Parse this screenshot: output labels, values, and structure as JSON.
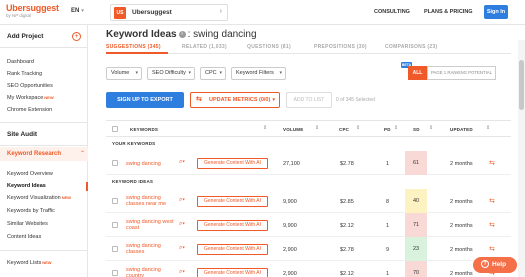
{
  "header": {
    "logo": "Ubersuggest",
    "logo_sub": "by NP digital",
    "language": "EN",
    "project_badge": "US",
    "project_name": "Ubersuggest",
    "nav": [
      "CONSULTING",
      "PLANS & PRICING"
    ],
    "signin": "Sign In"
  },
  "sidebar": {
    "add_project": "Add Project",
    "top_items": [
      {
        "label": "Dashboard",
        "new": false
      },
      {
        "label": "Rank Tracking",
        "new": false
      },
      {
        "label": "SEO Opportunities",
        "new": false
      },
      {
        "label": "My Workspace",
        "new": true
      },
      {
        "label": "Chrome Extension",
        "new": false
      }
    ],
    "site_audit": "Site Audit",
    "keyword_research": "Keyword Research",
    "kr_items": [
      {
        "label": "Keyword Overview",
        "new": false,
        "active": false
      },
      {
        "label": "Keyword Ideas",
        "new": false,
        "active": true
      },
      {
        "label": "Keyword Visualization",
        "new": true,
        "active": false
      },
      {
        "label": "Keywords by Traffic",
        "new": false,
        "active": false
      },
      {
        "label": "Similar Websites",
        "new": false,
        "active": false
      },
      {
        "label": "Content Ideas",
        "new": false,
        "active": false
      }
    ],
    "keyword_lists": "Keyword Lists",
    "new_label": "NEW"
  },
  "main": {
    "title_bold": "Keyword Ideas",
    "title_term": "swing dancing",
    "tabs": [
      "SUGGESTIONS (345)",
      "RELATED (1,033)",
      "QUESTIONS (81)",
      "PREPOSITIONS (30)",
      "COMPARISONS (23)"
    ],
    "filters": [
      "Volume",
      "SEO Difficulty",
      "CPC",
      "Keyword Filters"
    ],
    "beta": "BETA",
    "seg_all": "ALL",
    "seg_page": "PAGE 1 RANKING POTENTIAL",
    "export_btn": "SIGN UP TO EXPORT",
    "update_btn": "UPDATE METRICS (0/0)",
    "add_list_btn": "ADD TO LIST",
    "selected": "0 of 345 Selected",
    "table": {
      "headers": [
        "KEYWORDS",
        "VOLUME",
        "CPC",
        "PD",
        "SD",
        "UPDATED"
      ],
      "your_keywords_label": "YOUR KEYWORDS",
      "keyword_ideas_label": "KEYWORD IDEAS",
      "generate_label": "Generate Content With AI",
      "your_keywords": [
        {
          "keyword": "swing dancing",
          "volume": "27,100",
          "cpc": "$2.78",
          "pd": "1",
          "sd": "61",
          "updated": "2 months"
        }
      ],
      "ideas": [
        {
          "keyword": "swing dancing classes near me",
          "volume": "9,900",
          "cpc": "$2.85",
          "pd": "8",
          "sd": "40",
          "updated": "2 months"
        },
        {
          "keyword": "swing dancing west coast",
          "volume": "9,900",
          "cpc": "$2.12",
          "pd": "1",
          "sd": "71",
          "updated": "2 months"
        },
        {
          "keyword": "swing dancing classes",
          "volume": "2,900",
          "cpc": "$2.78",
          "pd": "9",
          "sd": "23",
          "updated": "2 months"
        },
        {
          "keyword": "swing dancing country",
          "volume": "2,900",
          "cpc": "$2.12",
          "pd": "1",
          "sd": "70",
          "updated": "2 months"
        }
      ]
    }
  },
  "help": "Help",
  "colors": {
    "accent": "#f05a28",
    "primary": "#2e7ee0",
    "sd_low": "#d8f2dd",
    "sd_mid": "#fdf2c2",
    "sd_high": "#f9d9d6"
  }
}
